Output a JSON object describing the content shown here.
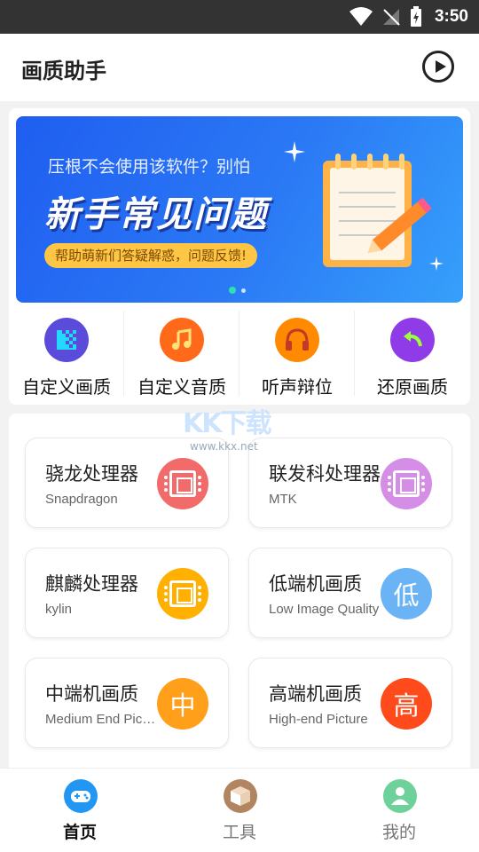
{
  "status_bar": {
    "time": "3:50"
  },
  "app_bar": {
    "title": "画质助手"
  },
  "banner": {
    "subtitle": "压根不会使用该软件？别怕",
    "headline": "新手常见问题",
    "pill": "帮助萌新们答疑解惑，问题反馈!"
  },
  "quick_actions": [
    {
      "label": "自定义画质",
      "color": "#5b4bdb",
      "icon": "mosaic-icon"
    },
    {
      "label": "自定义音质",
      "color": "#ff6a1a",
      "icon": "music-note-icon"
    },
    {
      "label": "听声辩位",
      "color": "#ff8a00",
      "icon": "headphones-icon"
    },
    {
      "label": "还原画质",
      "color": "#8f3ce8",
      "icon": "undo-arrow-icon"
    }
  ],
  "watermark": {
    "logo": "KK下载",
    "url": "www.kkx.net"
  },
  "items": [
    {
      "title": "骁龙处理器",
      "subtitle": "Snapdragon",
      "icon": "chip",
      "color": "#f26b6b"
    },
    {
      "title": "联发科处理器",
      "subtitle": "MTK",
      "icon": "chip",
      "color": "#d58ee6"
    },
    {
      "title": "麒麟处理器",
      "subtitle": "kylin",
      "icon": "chip",
      "color": "#ffb000"
    },
    {
      "title": "低端机画质",
      "subtitle": "Low Image Quality",
      "icon": "低",
      "color": "#6ab4f5"
    },
    {
      "title": "中端机画质",
      "subtitle": "Medium End Picture",
      "icon": "中",
      "color": "#ff9f1a"
    },
    {
      "title": "高端机画质",
      "subtitle": "High-end Picture",
      "icon": "高",
      "color": "#ff4a1c"
    }
  ],
  "tabs": [
    {
      "label": "首页",
      "active": true,
      "color": "#2196f3"
    },
    {
      "label": "工具",
      "active": false,
      "color": "#b08560"
    },
    {
      "label": "我的",
      "active": false,
      "color": "#6fd19a"
    }
  ]
}
